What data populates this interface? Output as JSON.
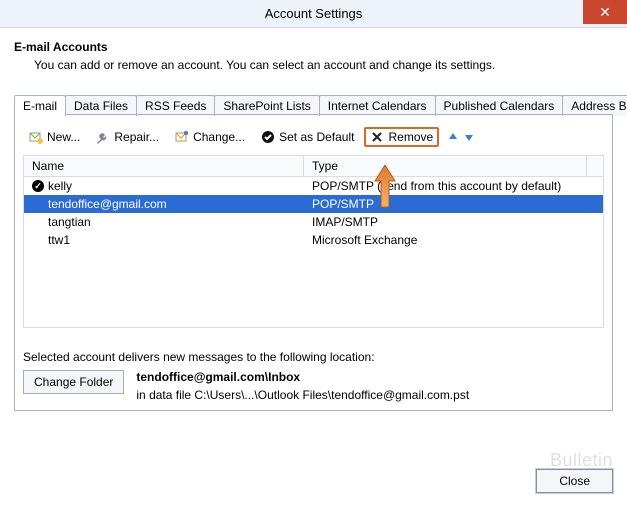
{
  "title": "Account Settings",
  "header": {
    "title": "E-mail Accounts",
    "subtitle": "You can add or remove an account. You can select an account and change its settings."
  },
  "tabs": [
    "E-mail",
    "Data Files",
    "RSS Feeds",
    "SharePoint Lists",
    "Internet Calendars",
    "Published Calendars",
    "Address Books"
  ],
  "toolbar": {
    "new": "New...",
    "repair": "Repair...",
    "change": "Change...",
    "default": "Set as Default",
    "remove": "Remove"
  },
  "columns": {
    "name": "Name",
    "type": "Type"
  },
  "rows": [
    {
      "name": "kelly",
      "type": "POP/SMTP (send from this account by default)",
      "default": true
    },
    {
      "name": "tendoffice@gmail.com",
      "type": "POP/SMTP",
      "selected": true
    },
    {
      "name": "tangtian",
      "type": "IMAP/SMTP"
    },
    {
      "name": "ttw1",
      "type": "Microsoft Exchange"
    }
  ],
  "deliver": {
    "label": "Selected account delivers new messages to the following location:",
    "button": "Change Folder",
    "path_bold": "tendoffice@gmail.com\\Inbox",
    "path_line": "in data file C:\\Users\\...\\Outlook Files\\tendoffice@gmail.com.pst"
  },
  "footer": {
    "close": "Close"
  },
  "watermark": "Bulletin"
}
